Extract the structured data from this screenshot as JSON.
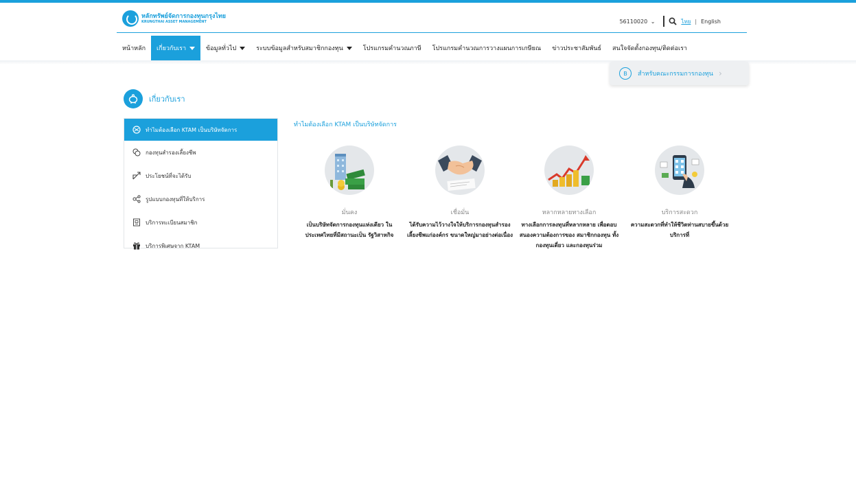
{
  "header": {
    "logo_th": "หลักทรัพย์จัดการกองทุนกรุงไทย",
    "logo_en": "KRUNGTHAI ASSET MANAGEMENT",
    "account": "56110020",
    "lang_th": "ไทย",
    "lang_sep": "|",
    "lang_en": "English"
  },
  "nav": {
    "items": [
      {
        "label": "หน้าหลัก"
      },
      {
        "label": "เกี่ยวกับเรา"
      },
      {
        "label": "ข้อมูลทั่วไป"
      },
      {
        "label": "ระบบข้อมูลสำหรับสมาชิกกองทุน"
      },
      {
        "label": "โปรแกรมคำนวณภาษี"
      },
      {
        "label": "โปรแกรมคำนวณการวางแผนการเกษียณ"
      },
      {
        "label": "ข่าวประชาสัมพันธ์"
      },
      {
        "label": "สนใจจัดตั้งกองทุน/ติดต่อเรา"
      }
    ]
  },
  "committee": {
    "label": "สำหรับคณะกรรมการกองทุน",
    "icon_text": "B"
  },
  "section": {
    "title": "เกี่ยวกับเรา"
  },
  "sidebar": {
    "items": [
      {
        "label": "ทำไมต้องเลือก KTAM เป็นบริษัทจัดการ"
      },
      {
        "label": "กองทุนสำรองเลี้ยงชีพ"
      },
      {
        "label": "ประโยชน์ที่จะได้รับ"
      },
      {
        "label": "รูปแบบกองทุนที่ให้บริการ"
      },
      {
        "label": "บริการทะเบียนสมาชิก"
      },
      {
        "label": "บริการพิเศษจาก KTAM"
      }
    ]
  },
  "content": {
    "title": "ทำไมต้องเลือก KTAM เป็นบริษัทจัดการ",
    "features": [
      {
        "title": "มั่นคง",
        "desc": "เป็นบริษัทจัดการกองทุนแห่งเดียว ในประเทศไทยที่มีสถานะเป็น รัฐวิสาหกิจ"
      },
      {
        "title": "เชื่อมั่น",
        "desc": "ได้รับความไว้วางใจให้บริการกองทุนสำรองเลี้ยงชีพแก่องค์กร ขนาดใหญ่มาอย่างต่อเนื่อง"
      },
      {
        "title": "หลากหลายทางเลือก",
        "desc": "ทางเลือกการลงทุนที่หลากหลาย เพื่อตอบสนองความต้องการของ สมาชิกกองทุน ทั้งกองทุนเดี่ยว และกองทุนร่วม"
      },
      {
        "title": "บริการสะดวก",
        "desc": "ความสะดวกที่ทำให้ชีวิตท่านสบายขึ้นด้วยบริการที่"
      }
    ]
  },
  "colors": {
    "accent": "#1ba0dc",
    "nav_active": "#1ba0dc",
    "panel_bg": "#eef0f2"
  }
}
